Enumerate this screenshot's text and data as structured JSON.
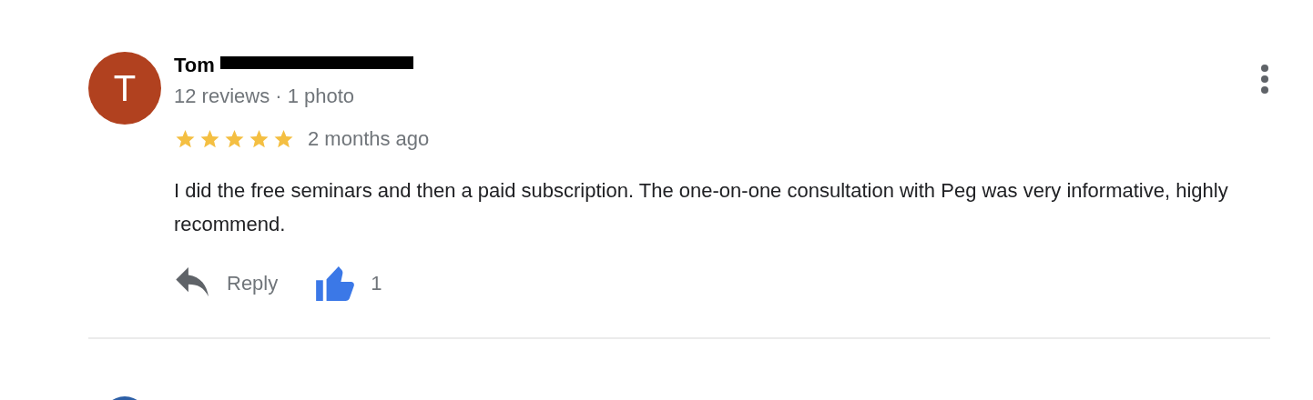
{
  "review": {
    "avatar_letter": "T",
    "name": "Tom",
    "meta": "12 reviews · 1 photo",
    "stars": 5,
    "time": "2 months ago",
    "text": "I did the free seminars and then a paid subscription. The one-on-one consultation with Peg was very informative, highly recommend.",
    "reply_label": "Reply",
    "liked": true,
    "like_count": "1"
  }
}
